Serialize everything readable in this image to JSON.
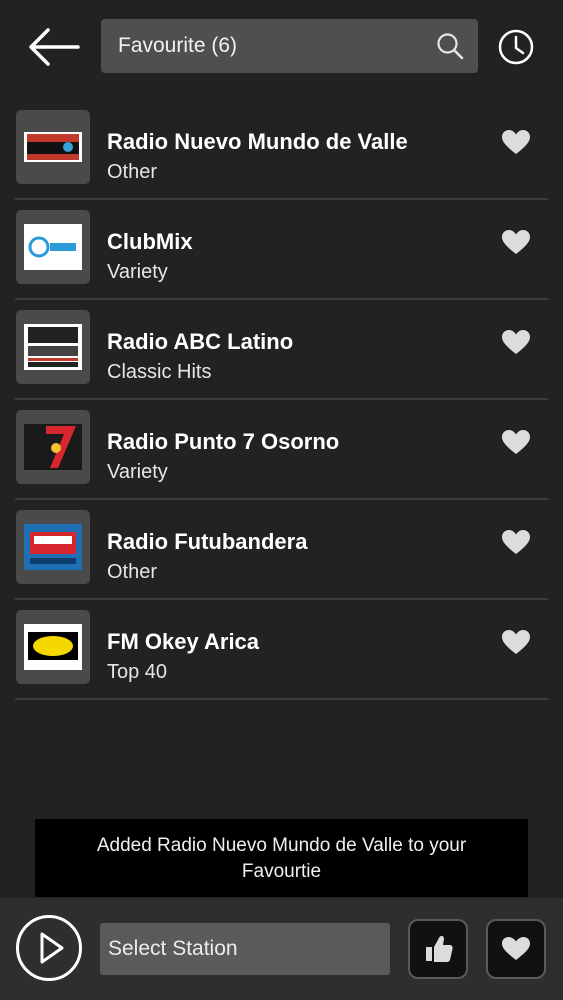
{
  "header": {
    "search_text": "Favourite (6)"
  },
  "stations": [
    {
      "name": "Radio Nuevo Mundo de Valle",
      "genre": "Other",
      "logo_text": "NUEVO MUNDO OVALLE 88.9FM"
    },
    {
      "name": "ClubMix",
      "genre": "Variety",
      "logo_text": "club mix"
    },
    {
      "name": "Radio ABC Latino",
      "genre": "Classic Hits",
      "logo_text": "ABC latino RADIO"
    },
    {
      "name": "Radio Punto 7 Osorno",
      "genre": "Variety",
      "logo_text": "Radio Punto 7"
    },
    {
      "name": "Radio Futubandera",
      "genre": "Other",
      "logo_text": "FUTU BANDERA ¡ES LA LUUUZ!"
    },
    {
      "name": "FM Okey Arica",
      "genre": "Top 40",
      "logo_text": "ok"
    }
  ],
  "toast": {
    "message": "Added Radio Nuevo Mundo de Valle to your Favourtie"
  },
  "player": {
    "station_label": "Select Station"
  },
  "colors": {
    "background": "#222222",
    "search_bg": "#4f4f4f",
    "divider": "#3c3c3c",
    "heart": "#dcdcdc"
  }
}
